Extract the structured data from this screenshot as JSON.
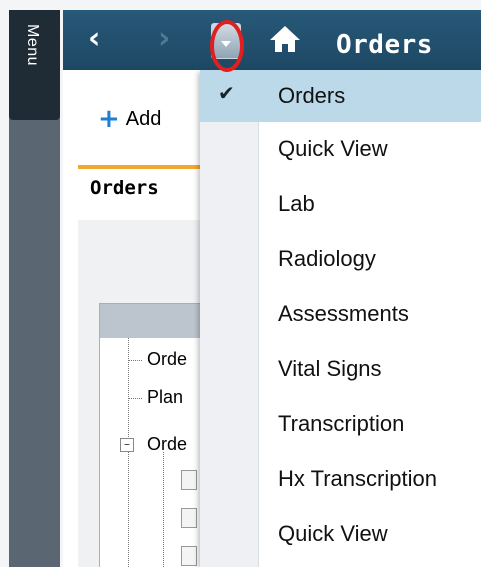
{
  "sidebar": {
    "menu_label": "Menu"
  },
  "nav": {
    "title": "Orders",
    "back_icon": "chevron-left-icon",
    "forward_icon": "chevron-right-icon",
    "home_icon": "home-icon",
    "dropdown_icon": "caret-down-icon"
  },
  "toolbar": {
    "add_label": "Add"
  },
  "main": {
    "tab_label": "Orders",
    "tree_items": [
      "Orde",
      "Plan",
      "Orde"
    ]
  },
  "dropdown": {
    "selected_index": 0,
    "items": [
      {
        "label": "Orders",
        "checked": true
      },
      {
        "label": "Quick View",
        "checked": false
      },
      {
        "label": "Lab",
        "checked": false
      },
      {
        "label": "Radiology",
        "checked": false
      },
      {
        "label": "Assessments",
        "checked": false
      },
      {
        "label": "Vital Signs",
        "checked": false
      },
      {
        "label": "Transcription",
        "checked": false
      },
      {
        "label": "Hx Transcription",
        "checked": false
      },
      {
        "label": "Quick View",
        "checked": false
      }
    ]
  },
  "colors": {
    "nav_bar": "#1d4864",
    "selected_item": "#bcd9e9",
    "tab_accent": "#f2a82f",
    "highlight_ring": "#e02020"
  }
}
